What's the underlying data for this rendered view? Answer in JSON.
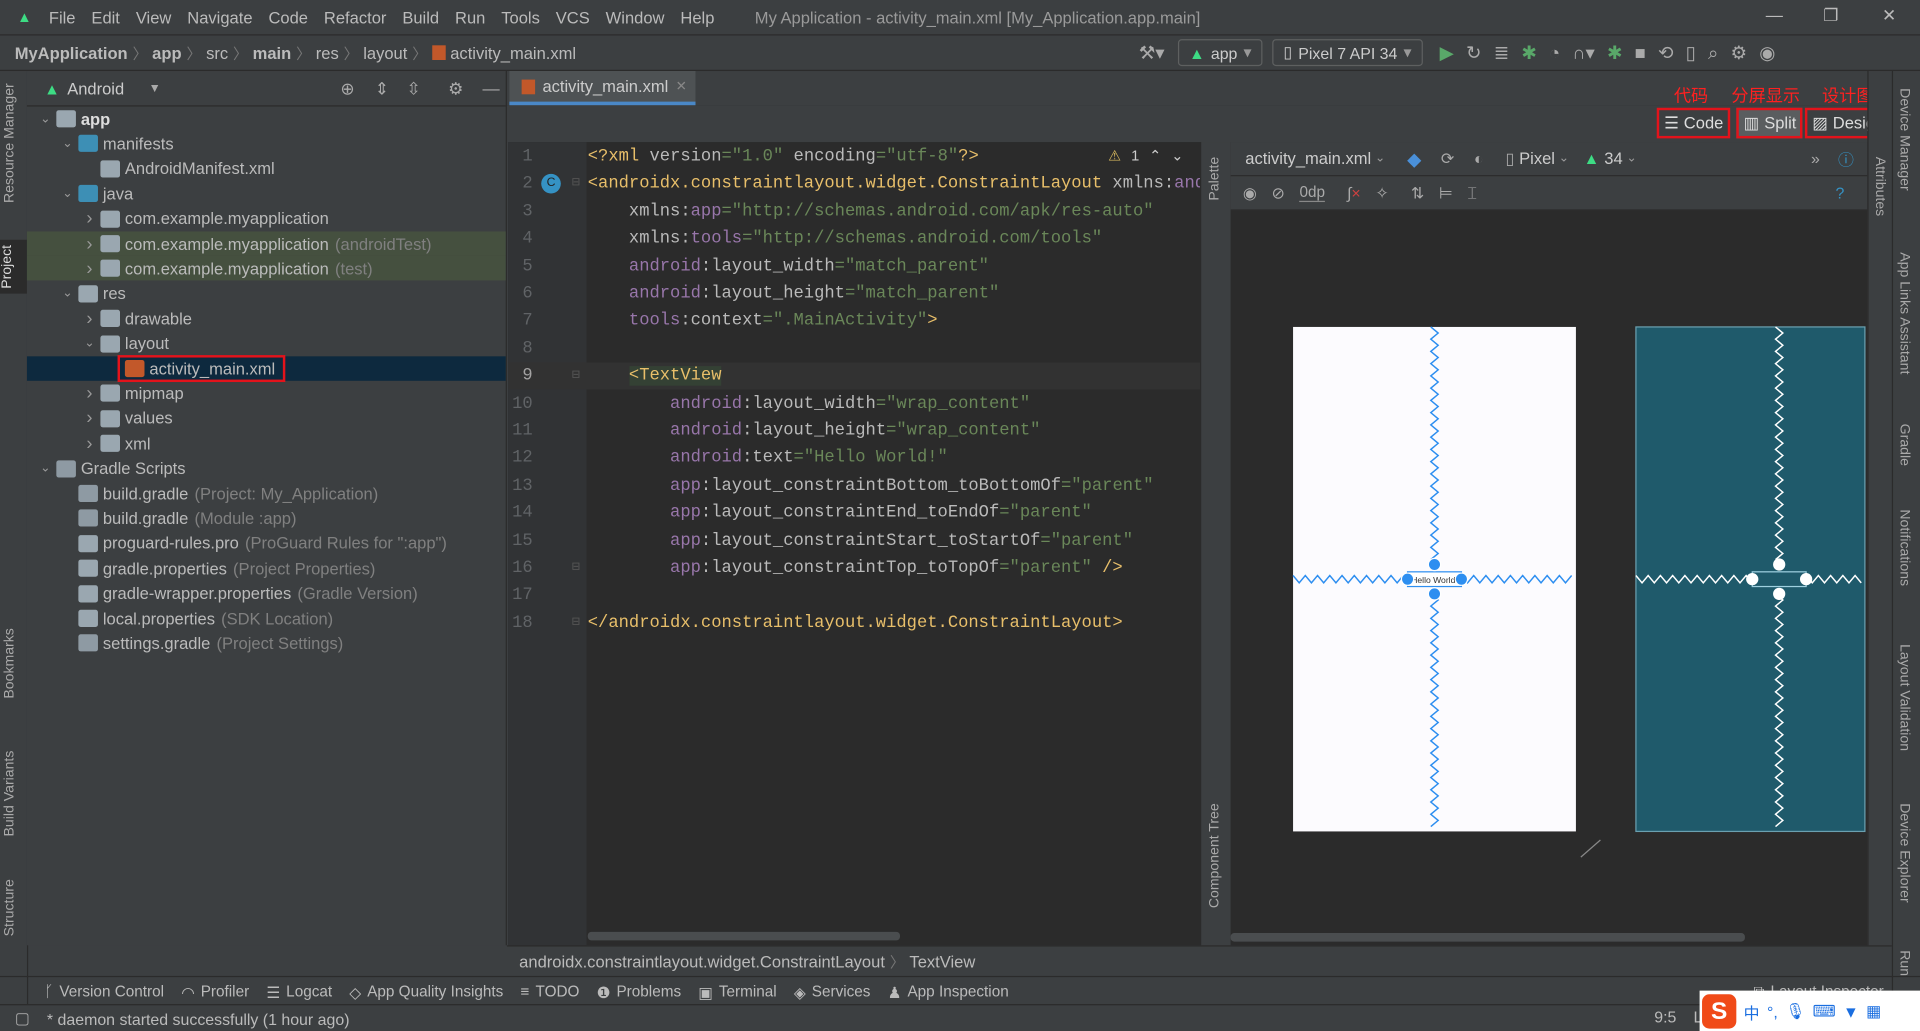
{
  "menubar": {
    "items": [
      "File",
      "Edit",
      "View",
      "Navigate",
      "Code",
      "Refactor",
      "Build",
      "Run",
      "Tools",
      "VCS",
      "Window",
      "Help"
    ],
    "window_title": "My Application - activity_main.xml [My_Application.app.main]"
  },
  "breadcrumb": [
    "MyApplication",
    "app",
    "src",
    "main",
    "res",
    "layout",
    "activity_main.xml"
  ],
  "run_config": {
    "module": "app",
    "device": "Pixel 7 API 34"
  },
  "left_stripe": {
    "resource_manager": "Resource Manager",
    "project": "Project",
    "bookmarks": "Bookmarks",
    "build_variants": "Build Variants",
    "structure": "Structure"
  },
  "project_panel": {
    "view_mode": "Android",
    "tree": [
      {
        "label": "app",
        "hint": "",
        "depth": 0,
        "arrow": "open",
        "icon": "module",
        "bold": true
      },
      {
        "label": "manifests",
        "hint": "",
        "depth": 1,
        "arrow": "open",
        "icon": "folder-blue"
      },
      {
        "label": "AndroidManifest.xml",
        "hint": "",
        "depth": 2,
        "arrow": "none",
        "icon": "manifest"
      },
      {
        "label": "java",
        "hint": "",
        "depth": 1,
        "arrow": "open",
        "icon": "folder-blue"
      },
      {
        "label": "com.example.myapplication",
        "hint": "",
        "depth": 2,
        "arrow": "closed",
        "icon": "package"
      },
      {
        "label": "com.example.myapplication",
        "hint": "(androidTest)",
        "depth": 2,
        "arrow": "closed",
        "icon": "package",
        "highlight": "green"
      },
      {
        "label": "com.example.myapplication",
        "hint": "(test)",
        "depth": 2,
        "arrow": "closed",
        "icon": "package",
        "highlight": "green"
      },
      {
        "label": "res",
        "hint": "",
        "depth": 1,
        "arrow": "open",
        "icon": "res"
      },
      {
        "label": "drawable",
        "hint": "",
        "depth": 2,
        "arrow": "closed",
        "icon": "package"
      },
      {
        "label": "layout",
        "hint": "",
        "depth": 2,
        "arrow": "open",
        "icon": "package"
      },
      {
        "label": "activity_main.xml",
        "hint": "",
        "depth": 3,
        "arrow": "none",
        "icon": "xml",
        "highlight": "selected",
        "boxed": true
      },
      {
        "label": "mipmap",
        "hint": "",
        "depth": 2,
        "arrow": "closed",
        "icon": "package"
      },
      {
        "label": "values",
        "hint": "",
        "depth": 2,
        "arrow": "closed",
        "icon": "package"
      },
      {
        "label": "xml",
        "hint": "",
        "depth": 2,
        "arrow": "closed",
        "icon": "package"
      },
      {
        "label": "Gradle Scripts",
        "hint": "",
        "depth": 0,
        "arrow": "open",
        "icon": "gradle"
      },
      {
        "label": "build.gradle",
        "hint": "(Project: My_Application)",
        "depth": 1,
        "arrow": "none",
        "icon": "gradle"
      },
      {
        "label": "build.gradle",
        "hint": "(Module :app)",
        "depth": 1,
        "arrow": "none",
        "icon": "gradle"
      },
      {
        "label": "proguard-rules.pro",
        "hint": "(ProGuard Rules for \":app\")",
        "depth": 1,
        "arrow": "none",
        "icon": "text-file"
      },
      {
        "label": "gradle.properties",
        "hint": "(Project Properties)",
        "depth": 1,
        "arrow": "none",
        "icon": "properties"
      },
      {
        "label": "gradle-wrapper.properties",
        "hint": "(Gradle Version)",
        "depth": 1,
        "arrow": "none",
        "icon": "properties"
      },
      {
        "label": "local.properties",
        "hint": "(SDK Location)",
        "depth": 1,
        "arrow": "none",
        "icon": "properties"
      },
      {
        "label": "settings.gradle",
        "hint": "(Project Settings)",
        "depth": 1,
        "arrow": "none",
        "icon": "gradle"
      }
    ]
  },
  "editor": {
    "tab": "activity_main.xml",
    "modes": {
      "code": "Code",
      "split": "Split",
      "design": "Design"
    },
    "mode_annotations": {
      "code": "代码",
      "split": "分屏显示",
      "design": "设计图"
    },
    "selected_mode": "split",
    "warnings": "1",
    "current_line": 9,
    "lines": [
      [
        [
          "<?xml ",
          "t-tag"
        ],
        [
          "version",
          "t-attr"
        ],
        [
          "=\"1.0\"",
          "t-val"
        ],
        [
          " encoding",
          "t-attr"
        ],
        [
          "=\"utf-8\"",
          "t-val"
        ],
        [
          "?>",
          "t-tag"
        ]
      ],
      [
        [
          "<androidx.constraintlayout.widget.ConstraintLayout ",
          "t-tag"
        ],
        [
          "xmlns:",
          "t-attr"
        ],
        [
          "android",
          "t-ns"
        ],
        [
          "=\"http://schemas.android.com/apk/res/android\"",
          "t-val"
        ]
      ],
      [
        [
          "    xmlns:",
          "t-attr"
        ],
        [
          "app",
          "t-ns"
        ],
        [
          "=\"http://schemas.android.com/apk/res-auto\"",
          "t-val"
        ]
      ],
      [
        [
          "    xmlns:",
          "t-attr"
        ],
        [
          "tools",
          "t-ns"
        ],
        [
          "=\"http://schemas.android.com/tools\"",
          "t-val"
        ]
      ],
      [
        [
          "    android",
          "t-ns"
        ],
        [
          ":layout_width",
          "t-attr"
        ],
        [
          "=\"match_parent\"",
          "t-val"
        ]
      ],
      [
        [
          "    android",
          "t-ns"
        ],
        [
          ":layout_height",
          "t-attr"
        ],
        [
          "=\"match_parent\"",
          "t-val"
        ]
      ],
      [
        [
          "    tools",
          "t-ns"
        ],
        [
          ":context",
          "t-attr"
        ],
        [
          "=\".MainActivity\"",
          "t-val"
        ],
        [
          ">",
          "t-tag"
        ]
      ],
      [],
      [
        [
          "    ",
          "t-plain"
        ],
        [
          "<TextView",
          "t-tag"
        ]
      ],
      [
        [
          "        android",
          "t-ns"
        ],
        [
          ":layout_width",
          "t-attr"
        ],
        [
          "=\"wrap_content\"",
          "t-val"
        ]
      ],
      [
        [
          "        android",
          "t-ns"
        ],
        [
          ":layout_height",
          "t-attr"
        ],
        [
          "=\"wrap_content\"",
          "t-val"
        ]
      ],
      [
        [
          "        android",
          "t-ns"
        ],
        [
          ":text",
          "t-attr"
        ],
        [
          "=\"Hello World!\"",
          "t-val"
        ]
      ],
      [
        [
          "        app",
          "t-ns"
        ],
        [
          ":layout_constraintBottom_toBottomOf",
          "t-attr"
        ],
        [
          "=\"parent\"",
          "t-val"
        ]
      ],
      [
        [
          "        app",
          "t-ns"
        ],
        [
          ":layout_constraintEnd_toEndOf",
          "t-attr"
        ],
        [
          "=\"parent\"",
          "t-val"
        ]
      ],
      [
        [
          "        app",
          "t-ns"
        ],
        [
          ":layout_constraintStart_toStartOf",
          "t-attr"
        ],
        [
          "=\"parent\"",
          "t-val"
        ]
      ],
      [
        [
          "        app",
          "t-ns"
        ],
        [
          ":layout_constraintTop_toTopOf",
          "t-attr"
        ],
        [
          "=\"parent\"",
          "t-val"
        ],
        [
          " />",
          "t-tag"
        ]
      ],
      [],
      [
        [
          "</androidx.constraintlayout.widget.ConstraintLayout>",
          "t-tag"
        ]
      ]
    ]
  },
  "design": {
    "file": "activity_main.xml",
    "device": "Pixel",
    "api": "34",
    "margin": "0dp",
    "preview_text": "Hello World!",
    "palette_label": "Palette",
    "component_tree_label": "Component Tree",
    "blueprint_color": "#1f5a6b",
    "constraint_color": "#2d8ef0"
  },
  "right_stripe": [
    "Device Manager",
    "App Links Assistant",
    "Gradle",
    "Notifications",
    "Layout Validation",
    "Device Explorer",
    "Run"
  ],
  "attributes_label": "Attributes",
  "bottom_breadcrumb": [
    "androidx.constraintlayout.widget.ConstraintLayout",
    "TextView"
  ],
  "tool_windows": [
    "Version Control",
    "Profiler",
    "Logcat",
    "App Quality Insights",
    "TODO",
    "Problems",
    "Terminal",
    "Services",
    "App Inspection"
  ],
  "layout_inspector": "Layout Inspector",
  "status": {
    "message": "* daemon started successfully (1 hour ago)",
    "caret": "9:5",
    "encoding_hint": "L"
  }
}
